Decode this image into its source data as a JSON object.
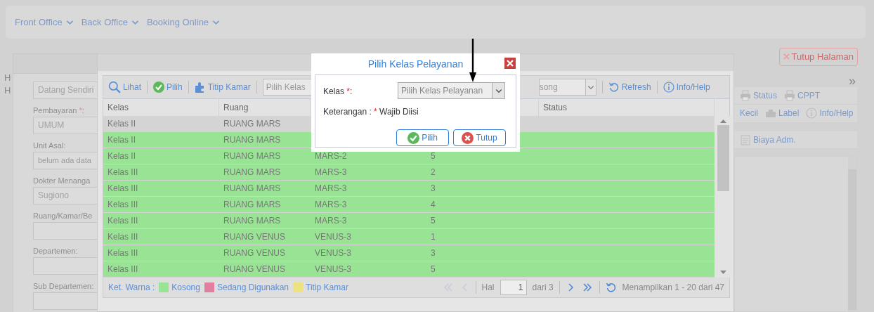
{
  "top_menu": [
    {
      "label": "Front Office"
    },
    {
      "label": "Back Office"
    },
    {
      "label": "Booking Online"
    }
  ],
  "side_letters": [
    "H",
    "H"
  ],
  "registration_form": {
    "fields": [
      {
        "value": "Datang Sendiri"
      },
      {
        "label": "Pembayaran ",
        "required_mark": "*",
        "label_end": ":",
        "value": "UMUM"
      },
      {
        "label": "Unit Asal:",
        "placeholder": "belum ada data"
      },
      {
        "label": "Dokter Menanga",
        "value": "Sugiono"
      },
      {
        "label": "Ruang/Kamar/Be"
      },
      {
        "label": "Departemen:"
      },
      {
        "label": "Sub Departemen:"
      }
    ]
  },
  "close_page_button": "Tutup Halaman",
  "side_panel": {
    "expand_icon": "»",
    "toolbar_rows": [
      [
        {
          "kind": "print",
          "label": "Status"
        },
        {
          "kind": "print",
          "label": "CPPT"
        }
      ],
      [
        {
          "kind": "text",
          "label": "Kecil"
        },
        {
          "kind": "tray",
          "label": "Label"
        },
        {
          "kind": "info",
          "label": "Info/Help"
        }
      ],
      [
        {
          "kind": "document",
          "label": "Biaya Adm."
        }
      ]
    ]
  },
  "room_window": {
    "toolbar": [
      {
        "kind": "search",
        "label": "Lihat"
      },
      {
        "kind": "ok",
        "label": "Pilih"
      },
      {
        "kind": "puzzle",
        "label": "Titip Kamar"
      }
    ],
    "class_filter": {
      "placeholder": "Pilih Kelas"
    },
    "status_filter": {
      "value": "song"
    },
    "toolbar_end": [
      {
        "kind": "refresh",
        "label": "Refresh"
      },
      {
        "kind": "info",
        "label": "Info/Help"
      }
    ],
    "table": {
      "columns": {
        "column_1": "Kelas",
        "column_2": "Ruang",
        "column_5": "Status"
      },
      "rows": [
        {
          "column_1": "Kelas II",
          "column_2": "RUANG MARS",
          "selected": true
        },
        {
          "column_1": "Kelas II",
          "column_2": "RUANG MARS",
          "selected": false
        },
        {
          "column_1": "Kelas II",
          "column_2": "RUANG MARS",
          "column_3": "MARS-2",
          "column_4": "5",
          "selected": false
        },
        {
          "column_1": "Kelas III",
          "column_2": "RUANG MARS",
          "column_3": "MARS-3",
          "column_4": "2",
          "selected": false
        },
        {
          "column_1": "Kelas III",
          "column_2": "RUANG MARS",
          "column_3": "MARS-3",
          "column_4": "3",
          "selected": false
        },
        {
          "column_1": "Kelas III",
          "column_2": "RUANG MARS",
          "column_3": "MARS-3",
          "column_4": "4",
          "selected": false
        },
        {
          "column_1": "Kelas III",
          "column_2": "RUANG MARS",
          "column_3": "MARS-3",
          "column_4": "5",
          "selected": false
        },
        {
          "column_1": "Kelas III",
          "column_2": "RUANG VENUS",
          "column_3": "VENUS-3",
          "column_4": "1",
          "selected": false
        },
        {
          "column_1": "Kelas III",
          "column_2": "RUANG VENUS",
          "column_3": "VENUS-3",
          "column_4": "3",
          "selected": false
        },
        {
          "column_1": "Kelas III",
          "column_2": "RUANG VENUS",
          "column_3": "VENUS-3",
          "column_4": "5",
          "selected": false
        }
      ]
    },
    "legend": {
      "title": "Ket. Warna :",
      "items": [
        {
          "label": "Kosong",
          "color": "#98e494"
        },
        {
          "label": "Sedang Digunakan",
          "color": "#e27fa0"
        },
        {
          "label": "Titip Kamar",
          "color": "#ece27f"
        }
      ]
    },
    "pager": {
      "back_buttons": [
        {
          "kind": "first",
          "disabled": true
        },
        {
          "kind": "previous",
          "disabled": true
        }
      ],
      "page_label": "Hal",
      "page": "1",
      "page_total": "dari 3",
      "forward_buttons": [
        {
          "kind": "next",
          "disabled": false
        },
        {
          "kind": "last",
          "disabled": false
        }
      ],
      "summary": "Menampilkan 1 - 20 dari 47"
    }
  },
  "dialog": {
    "title": "Pilih Kelas Pelayanan",
    "field": {
      "label": "Kelas ",
      "required_mark": "*",
      "label_end": ":",
      "placeholder": "Pilih Kelas Pelayanan"
    },
    "note": "Keterangan : ",
    "note_mark": "*",
    "note_end": " Wajib Diisi",
    "buttons": [
      {
        "kind": "ok",
        "label": "Pilih"
      },
      {
        "kind": "cancel",
        "label": "Tutup"
      }
    ]
  }
}
